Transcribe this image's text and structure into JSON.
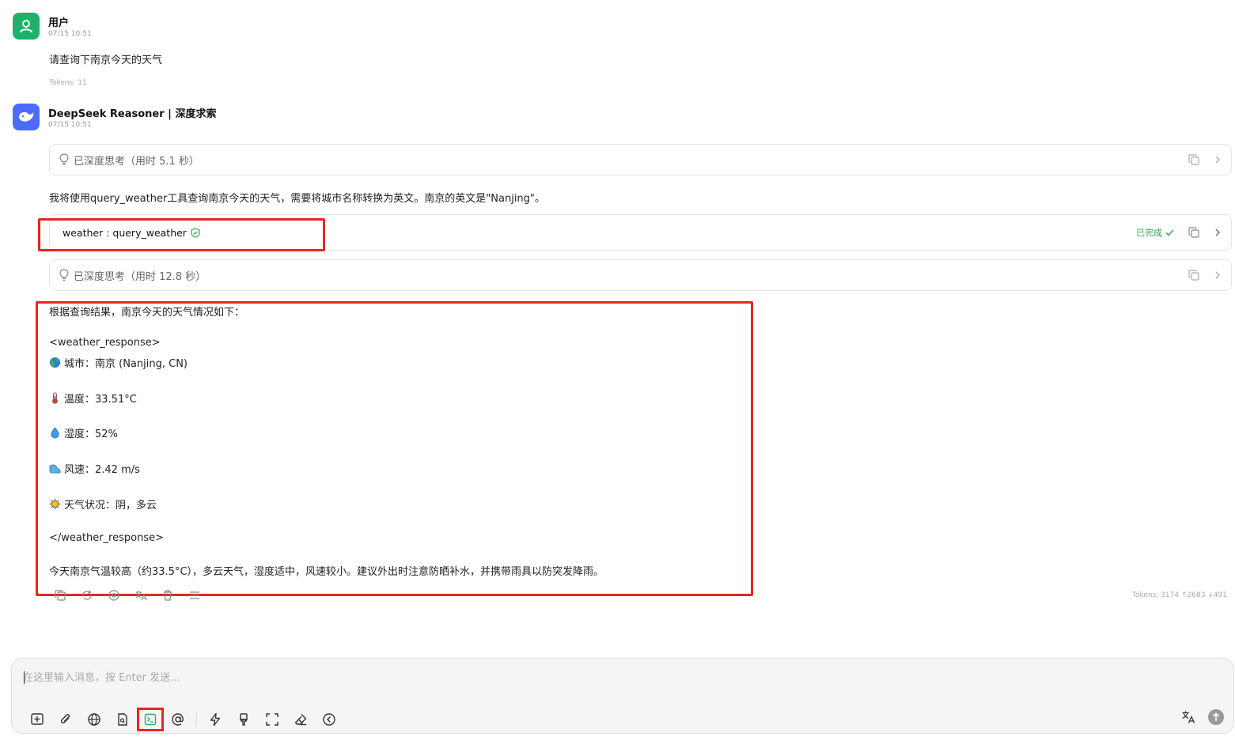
{
  "user_message": {
    "name": "用户",
    "time": "07/15 10:51",
    "text": "请查询下南京今天的天气",
    "tokens": "Tokens: 11"
  },
  "assistant_message": {
    "name": "DeepSeek Reasoner | 深度求索",
    "time": "07/15 10:51",
    "thinking_1": "已深度思考（用时 5.1 秒）",
    "intro_text": "我将使用query_weather工具查询南京今天的天气，需要将城市名称转换为英文。南京的英文是\"Nanjing\"。",
    "tool_call": {
      "label": "weather : query_weather",
      "status": "已完成"
    },
    "thinking_2": "已深度思考（用时 12.8 秒）",
    "response": {
      "line1": "根据查询结果，南京今天的天气情况如下：",
      "open_tag": "<weather_response>",
      "city": "城市：南京 (Nanjing, CN)",
      "temperature": "温度：33.51°C",
      "humidity": "湿度：52%",
      "wind": "风速：2.42 m/s",
      "condition": "天气状况：阴，多云",
      "close_tag": "</weather_response>",
      "summary": "今天南京气温较高（约33.5°C），多云天气，湿度适中，风速较小。建议外出时注意防晒补水，并携带雨具以防突发降雨。"
    },
    "tokens": "Tokens: 3174 ↑2683 ↓491"
  },
  "composer": {
    "placeholder": "在这里输入消息，按 Enter 发送..."
  },
  "colors": {
    "accent_green": "#1fb16a",
    "deepseek_blue": "#4d6bfe",
    "highlight_red": "#e8261f"
  }
}
